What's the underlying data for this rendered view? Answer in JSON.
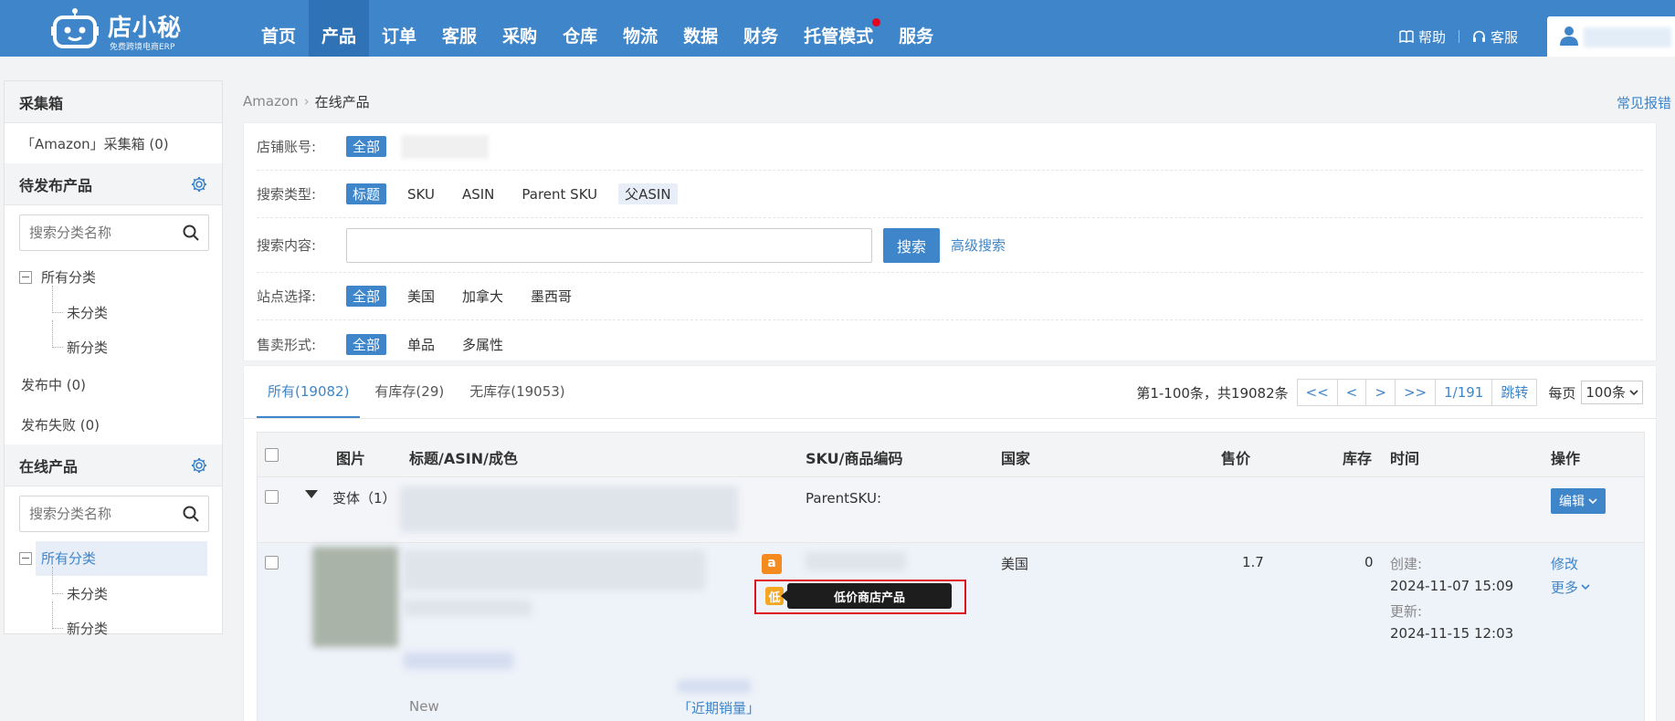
{
  "topbar": {
    "brand": "店小秘",
    "slogan": "免费跨境电商ERP",
    "nav": [
      "首页",
      "产品",
      "订单",
      "客服",
      "采购",
      "仓库",
      "物流",
      "数据",
      "财务",
      "托管模式",
      "服务"
    ],
    "help": "帮助",
    "service": "客服"
  },
  "sidebar": {
    "collect": {
      "title": "采集箱",
      "amazon_box": "「Amazon」采集箱 (0)"
    },
    "pending": {
      "title": "待发布产品",
      "search_placeholder": "搜索分类名称",
      "tree_root": "所有分类",
      "children": [
        "未分类",
        "新分类"
      ]
    },
    "publishing": "发布中 (0)",
    "failed": "发布失败 (0)",
    "online": {
      "title": "在线产品",
      "search_placeholder": "搜索分类名称",
      "tree_root": "所有分类",
      "children": [
        "未分类",
        "新分类"
      ]
    }
  },
  "breadcrumb": {
    "parent": "Amazon",
    "current": "在线产品"
  },
  "faq": "常见报错",
  "filters": {
    "shop": {
      "label": "店铺账号:",
      "all": "全部"
    },
    "search_type": {
      "label": "搜索类型:",
      "options": [
        "标题",
        "SKU",
        "ASIN",
        "Parent SKU",
        "父ASIN"
      ]
    },
    "search_content": {
      "label": "搜索内容:",
      "button": "搜索",
      "advanced": "高级搜索"
    },
    "site": {
      "label": "站点选择:",
      "options": [
        "全部",
        "美国",
        "加拿大",
        "墨西哥"
      ]
    },
    "sale_form": {
      "label": "售卖形式:",
      "options": [
        "全部",
        "单品",
        "多属性"
      ]
    }
  },
  "tabs": [
    "所有(19082)",
    "有库存(29)",
    "无库存(19053)"
  ],
  "pager": {
    "info": "第1-100条，共19082条",
    "first": "<<",
    "prev": "<",
    "next": ">",
    "last": ">>",
    "page": "1/191",
    "jump": "跳转",
    "per_page_label": "每页",
    "per_page": "100条"
  },
  "table": {
    "headers": [
      "图片",
      "标题/ASIN/成色",
      "SKU/商品编码",
      "国家",
      "售价",
      "库存",
      "时间",
      "操作"
    ],
    "variant_row": {
      "label": "变体（1）",
      "parent_sku": "ParentSKU:",
      "edit": "编辑"
    },
    "product_row": {
      "amazon_badge": "a",
      "low_badge": "低",
      "tooltip": "低价商店产品",
      "country": "美国",
      "price": "1.7",
      "stock": "0",
      "created_label": "创建:",
      "created": "2024-11-07 15:09",
      "updated_label": "更新:",
      "updated": "2024-11-15 12:03",
      "modify": "修改",
      "more": "更多",
      "condition": "New",
      "recent_sales": "「近期销量」"
    }
  }
}
